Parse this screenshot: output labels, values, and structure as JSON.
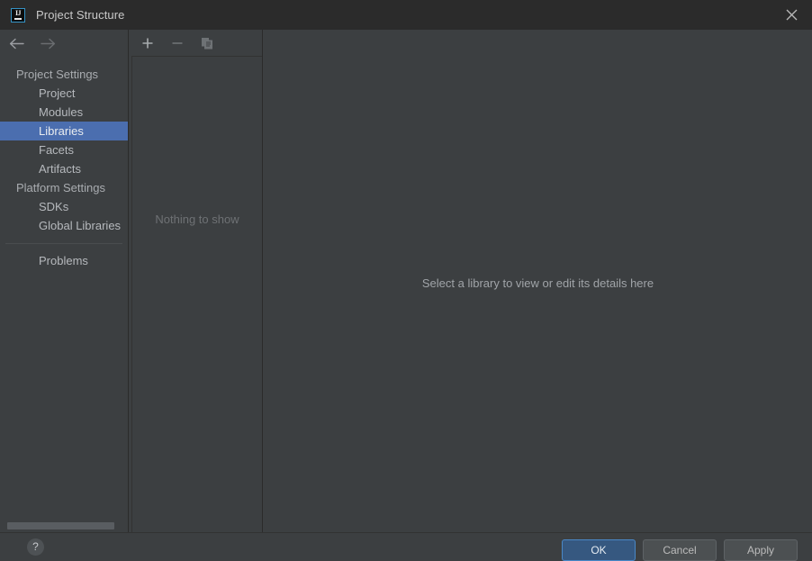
{
  "window": {
    "title": "Project Structure",
    "app_icon": "intellij-idea-icon",
    "close_icon": "close-icon"
  },
  "navigation": {
    "back_icon": "arrow-left-icon",
    "forward_icon": "arrow-right-icon"
  },
  "sidebar": {
    "groups": [
      {
        "label": "Project Settings",
        "items": [
          {
            "label": "Project",
            "selected": false
          },
          {
            "label": "Modules",
            "selected": false
          },
          {
            "label": "Libraries",
            "selected": true
          },
          {
            "label": "Facets",
            "selected": false
          },
          {
            "label": "Artifacts",
            "selected": false
          }
        ]
      },
      {
        "label": "Platform Settings",
        "items": [
          {
            "label": "SDKs",
            "selected": false
          },
          {
            "label": "Global Libraries",
            "selected": false
          }
        ]
      }
    ],
    "extra_items": [
      {
        "label": "Problems",
        "selected": false
      }
    ]
  },
  "list_panel": {
    "toolbar": {
      "add_label": "+",
      "add_icon": "plus-icon",
      "remove_label": "−",
      "remove_icon": "minus-icon",
      "copy_icon": "copy-icon"
    },
    "empty_message": "Nothing to show"
  },
  "detail_panel": {
    "hint": "Select a library to view or edit its details here"
  },
  "bottom_bar": {
    "help_icon": "help-icon",
    "help_label": "?",
    "buttons": [
      {
        "label": "OK",
        "primary": true
      },
      {
        "label": "Cancel",
        "primary": false
      },
      {
        "label": "Apply",
        "primary": false
      }
    ]
  },
  "colors": {
    "window_bg": "#3c3f41",
    "titlebar_bg": "#2b2b2b",
    "selection_blue": "#4b6eaf",
    "primary_button": "#365880",
    "text_primary": "#b6b9bd",
    "text_muted": "#6e7174"
  }
}
